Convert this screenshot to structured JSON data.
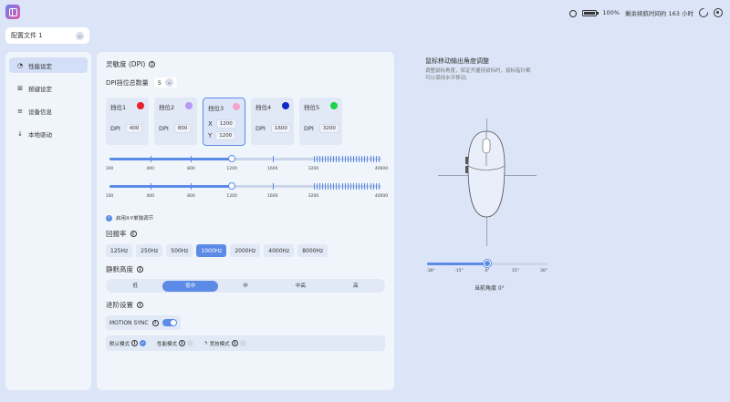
{
  "topbar": {
    "battery_text": "100%",
    "remaining_text": "剩余续航时间约 163 小时"
  },
  "profile": {
    "selected": "配置文件 1"
  },
  "sidebar": {
    "items": [
      {
        "label": "性能设定",
        "icon": "performance-icon",
        "active": true
      },
      {
        "label": "按键设定",
        "icon": "button-icon",
        "active": false
      },
      {
        "label": "设备信息",
        "icon": "list-icon",
        "active": false
      },
      {
        "label": "本地驱动",
        "icon": "download-icon",
        "active": false
      }
    ]
  },
  "dpi": {
    "title": "灵敏度 (DPI)",
    "count_label": "DPI挡位总数量",
    "count_value": "5",
    "slots": [
      {
        "label": "挡位1",
        "color": "#e8202a",
        "dpi": "400"
      },
      {
        "label": "挡位2",
        "color": "#b49af0",
        "dpi": "800"
      },
      {
        "label": "挡位3",
        "color": "#f7a3cc",
        "x": "1200",
        "y": "1200"
      },
      {
        "label": "挡位4",
        "color": "#1428c8",
        "dpi": "1600"
      },
      {
        "label": "挡位5",
        "color": "#1ed24a",
        "dpi": "3200"
      }
    ],
    "dpi_prefix": "DPI",
    "x_prefix": "X",
    "y_prefix": "Y",
    "scale_labels": [
      "100",
      "400",
      "800",
      "1200",
      "1600",
      "3200",
      "40000"
    ],
    "xy_label": "启用X-Y单独调节"
  },
  "polling": {
    "title": "回报率",
    "options": [
      "125Hz",
      "250Hz",
      "500Hz",
      "1000Hz",
      "2000Hz",
      "4000Hz",
      "8000Hz"
    ],
    "selected": "1000Hz"
  },
  "lod": {
    "title": "静默高度",
    "options": [
      "低",
      "低中",
      "中",
      "中高",
      "高"
    ],
    "selected": "低中"
  },
  "advanced": {
    "title": "进阶设置",
    "motion_sync": "MOTION SYNC",
    "modes": [
      "默认模式",
      "性能模式",
      "竞技模式"
    ]
  },
  "angle": {
    "title": "鼠标移动输出角度调整",
    "desc": "调整鼠标角度，保证齐握持鼠标时，鼠标指针都可以保持水平移动。",
    "labels": [
      "-30°",
      "-15°",
      "0°",
      "15°",
      "30°"
    ],
    "current": "当前角度 0°",
    "value": 0
  },
  "colors": {
    "accent": "#5b8be6"
  }
}
